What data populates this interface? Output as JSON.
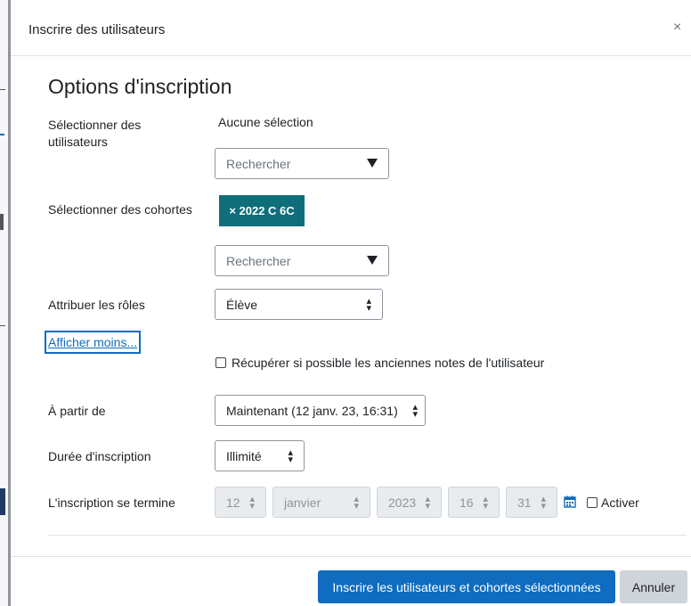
{
  "modal": {
    "title": "Inscrire des utilisateurs",
    "close": "×"
  },
  "section": {
    "title": "Options d'inscription"
  },
  "users": {
    "label": "Sélectionner des utilisateurs",
    "selection": "Aucune sélection",
    "search_placeholder": "Rechercher"
  },
  "cohorts": {
    "label": "Sélectionner des cohortes",
    "tag": "× 2022 C 6C",
    "search_placeholder": "Rechercher"
  },
  "roles": {
    "label": "Attribuer les rôles",
    "selected": "Élève"
  },
  "show_less": "Afficher moins...",
  "recover_grades": "Récupérer si possible les anciennes notes de l'utilisateur",
  "start": {
    "label": "À partir de",
    "selected": "Maintenant (12 janv. 23, 16:31)"
  },
  "duration": {
    "label": "Durée d'inscription",
    "selected": "Illimité"
  },
  "end": {
    "label": "L'inscription se termine",
    "day": "12",
    "month": "janvier",
    "year": "2023",
    "hour": "16",
    "minute": "31",
    "enable": "Activer"
  },
  "footer": {
    "submit": "Inscrire les utilisateurs et cohortes sélectionnées",
    "cancel": "Annuler"
  },
  "colors": {
    "primary": "#0f6cbf",
    "tag": "#0f6e7a",
    "cancel": "#ced4da"
  }
}
